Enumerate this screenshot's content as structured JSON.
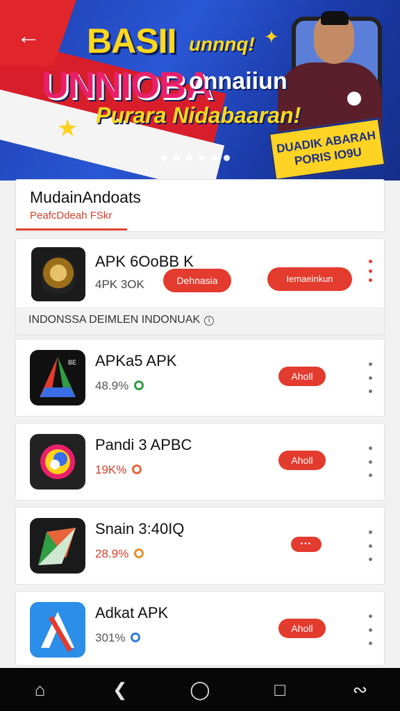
{
  "banner": {
    "headline_1": "BASII",
    "headline_1b": "unnnq!",
    "headline_2": "UNNIOBA",
    "headline_2b": "onnaiiun",
    "headline_3": "Purara Nidabaaran!",
    "promo_line_1": "DUADIK ABARAH",
    "promo_line_2": "PORIS IO9U",
    "dots": 6,
    "brand_red": "#e0262b",
    "brand_blue": "#2a57d6"
  },
  "section": {
    "title": "MudainAndoats",
    "subtitle": "PeafcDdeah FSkr"
  },
  "featured": {
    "name": "APK 6OoBB K",
    "size": "4PK 3OK",
    "button_1": "Dehnasia",
    "button_2": "Iemaeinkun",
    "notice": "INDONSSA DEIMLEN INDONUAK"
  },
  "apps": [
    {
      "name": "APKa5 APK",
      "rating": "48.9%",
      "button": "Aholl",
      "icon": "gdrive-like-icon",
      "dot_color": "#2f9e44"
    },
    {
      "name": "Pandi 3 APBC",
      "rating": "19K%",
      "button": "Aholl",
      "icon": "colorful-swirl-icon",
      "dot_color": "#e8653a"
    },
    {
      "name": "Snain 3:40IQ",
      "rating": "28.9%",
      "button": "•••",
      "icon": "arrow-map-icon",
      "dot_color": "#e8902a"
    },
    {
      "name": "Adkat APK",
      "rating": "301%",
      "button": "Aholl",
      "icon": "blue-a-icon",
      "dot_color": "#2b7bd8"
    }
  ],
  "accent_color": "#e33b2e",
  "nav": [
    "home-icon",
    "back-icon",
    "circle-home-icon",
    "recents-icon",
    "assistant-icon"
  ]
}
